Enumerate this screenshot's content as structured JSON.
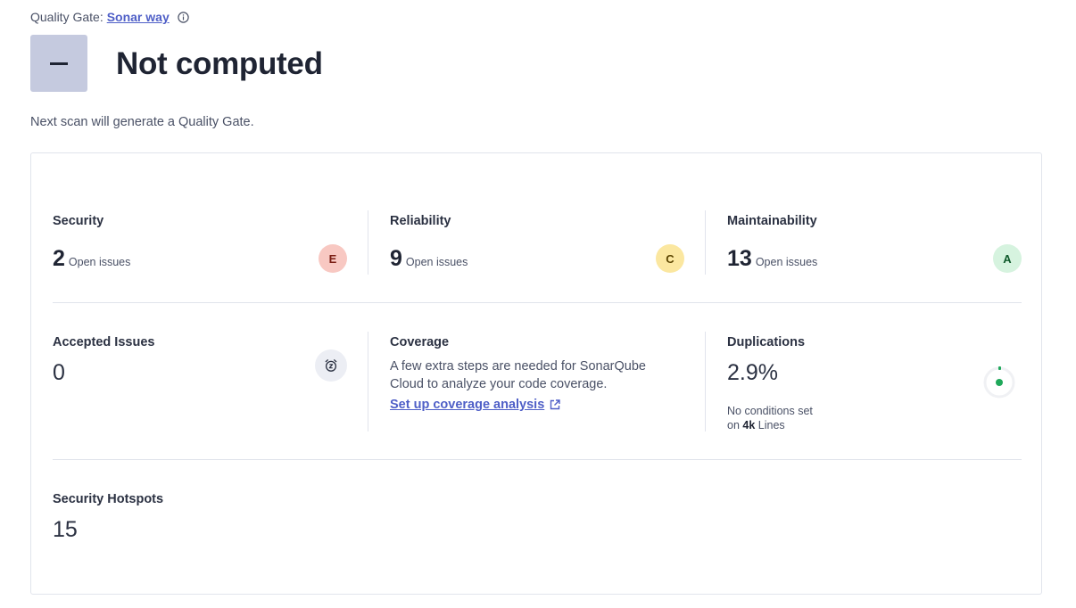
{
  "header": {
    "gate_label": "Quality Gate:",
    "gate_name": "Sonar way",
    "status_title": "Not computed",
    "next_scan_text": "Next scan will generate a Quality Gate."
  },
  "security": {
    "title": "Security",
    "count": "2",
    "label": "Open issues",
    "rating": "E"
  },
  "reliability": {
    "title": "Reliability",
    "count": "9",
    "label": "Open issues",
    "rating": "C"
  },
  "maintainability": {
    "title": "Maintainability",
    "count": "13",
    "label": "Open issues",
    "rating": "A"
  },
  "accepted": {
    "title": "Accepted Issues",
    "count": "0"
  },
  "coverage": {
    "title": "Coverage",
    "text": "A few extra steps are needed for SonarQube Cloud to analyze your code coverage.",
    "link": "Set up coverage analysis"
  },
  "duplications": {
    "title": "Duplications",
    "value": "2.9%",
    "note_line1": "No conditions set",
    "note_on": "on",
    "lines_count": "4k",
    "lines_label": "Lines"
  },
  "hotspots": {
    "title": "Security Hotspots",
    "count": "15"
  },
  "colors": {
    "link": "#4f5fc7",
    "status_box": "#c5cadf",
    "rating_e": "#f8c8c2",
    "rating_c": "#fbe7a0",
    "rating_a": "#d6f3df",
    "duplication_green": "#1fa85a"
  },
  "icons": {
    "info": "info-icon",
    "accepted": "alarm-clock-icon",
    "external_link": "external-link-icon",
    "duplication_gauge": "duplication-gauge-icon"
  }
}
